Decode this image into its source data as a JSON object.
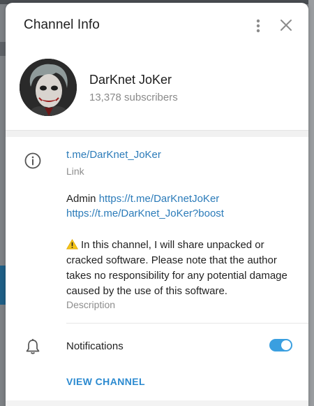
{
  "modal": {
    "title": "Channel Info"
  },
  "channel": {
    "name": "DarKnet JoKer",
    "subscribers": "13,378 subscribers"
  },
  "info": {
    "link": "t.me/DarKnet_JoKer",
    "link_caption": "Link",
    "admin_prefix": "Admin",
    "admin_link": "https://t.me/DarKnetJoKer",
    "boost_link": "https://t.me/DarKnet_JoKer?boost",
    "description": "In this channel, I will share unpacked or cracked software. Please note that the author takes no responsibility for any potential damage caused by the use of this software.",
    "description_caption": "Description"
  },
  "notifications": {
    "label": "Notifications",
    "enabled": true
  },
  "actions": {
    "view_channel": "VIEW CHANNEL"
  },
  "colors": {
    "accent": "#2b7bb9",
    "toggle_on": "#3a9fe0"
  },
  "icons": [
    "more-vertical-icon",
    "close-icon",
    "info-icon",
    "warning-icon",
    "bell-icon"
  ]
}
